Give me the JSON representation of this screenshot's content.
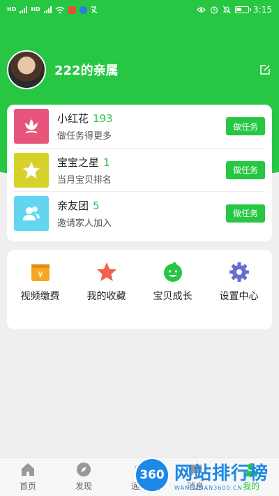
{
  "status_bar": {
    "left_chips": [
      "HD",
      "HD"
    ],
    "time": "3:15"
  },
  "profile": {
    "name": "222的亲属"
  },
  "tasks": [
    {
      "title": "小红花",
      "count": "193",
      "subtitle": "做任务得更多",
      "button": "做任务",
      "color": "#e8557a",
      "icon": "flower-icon"
    },
    {
      "title": "宝宝之星",
      "count": "1",
      "subtitle": "当月宝贝排名",
      "button": "做任务",
      "color": "#d8d12c",
      "icon": "star-icon"
    },
    {
      "title": "亲友团",
      "count": "5",
      "subtitle": "邀请家人加入",
      "button": "做任务",
      "color": "#63d5f0",
      "icon": "users-icon"
    }
  ],
  "grid": [
    {
      "label": "视频缴费",
      "icon": "payment-icon"
    },
    {
      "label": "我的收藏",
      "icon": "star-icon"
    },
    {
      "label": "宝贝成长",
      "icon": "baby-icon"
    },
    {
      "label": "设置中心",
      "icon": "gear-icon"
    }
  ],
  "tabbar": [
    {
      "label": "首页",
      "icon": "home-icon"
    },
    {
      "label": "发现",
      "icon": "compass-icon"
    },
    {
      "label": "通知",
      "icon": "bell-icon"
    },
    {
      "label": "消息",
      "icon": "chat-icon"
    },
    {
      "label": "我的",
      "icon": "user-icon"
    }
  ],
  "watermark": {
    "badge": "360",
    "title": "网站排行榜",
    "subtitle": "WANGZHAN3600.CN"
  },
  "colors": {
    "brand_green": "#27c743",
    "watermark_blue": "#1e88e5"
  }
}
